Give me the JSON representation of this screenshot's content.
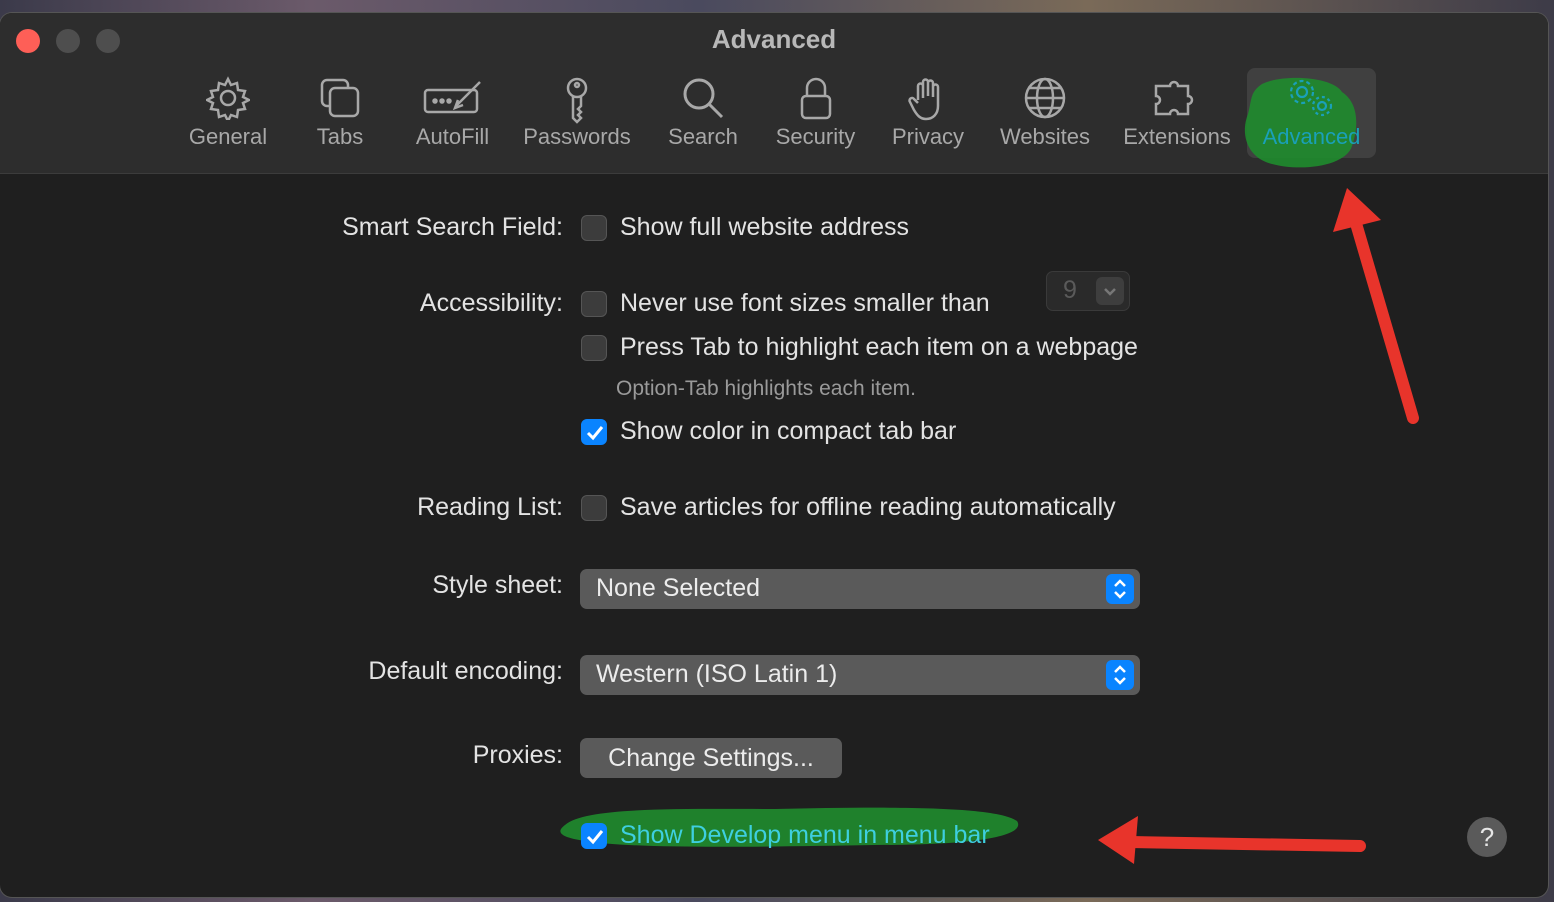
{
  "window": {
    "title": "Advanced"
  },
  "toolbar": {
    "tabs": [
      {
        "label": "General",
        "icon": "gear-icon"
      },
      {
        "label": "Tabs",
        "icon": "tabs-icon"
      },
      {
        "label": "AutoFill",
        "icon": "autofill-icon"
      },
      {
        "label": "Passwords",
        "icon": "key-icon"
      },
      {
        "label": "Search",
        "icon": "magnifier-icon"
      },
      {
        "label": "Security",
        "icon": "lock-icon"
      },
      {
        "label": "Privacy",
        "icon": "hand-icon"
      },
      {
        "label": "Websites",
        "icon": "globe-icon"
      },
      {
        "label": "Extensions",
        "icon": "puzzle-icon"
      },
      {
        "label": "Advanced",
        "icon": "gears-icon",
        "selected": true
      }
    ]
  },
  "settings": {
    "smart_search": {
      "label": "Smart Search Field:",
      "option": "Show full website address",
      "checked": false
    },
    "accessibility": {
      "label": "Accessibility:",
      "font_size_option": "Never use font sizes smaller than",
      "font_size_value": "9",
      "font_size_checked": false,
      "tab_option": "Press Tab to highlight each item on a webpage",
      "tab_checked": false,
      "tab_hint": "Option-Tab highlights each item.",
      "color_option": "Show color in compact tab bar",
      "color_checked": true
    },
    "reading_list": {
      "label": "Reading List:",
      "option": "Save articles for offline reading automatically",
      "checked": false
    },
    "style_sheet": {
      "label": "Style sheet:",
      "value": "None Selected"
    },
    "encoding": {
      "label": "Default encoding:",
      "value": "Western (ISO Latin 1)"
    },
    "proxies": {
      "label": "Proxies:",
      "button": "Change Settings..."
    },
    "develop": {
      "option": "Show Develop menu in menu bar",
      "checked": true
    }
  },
  "help": {
    "label": "?"
  },
  "colors": {
    "accent": "#0a84ff",
    "highlight_scribble": "#1f8a2e",
    "annotation_arrow": "#e8342b"
  }
}
